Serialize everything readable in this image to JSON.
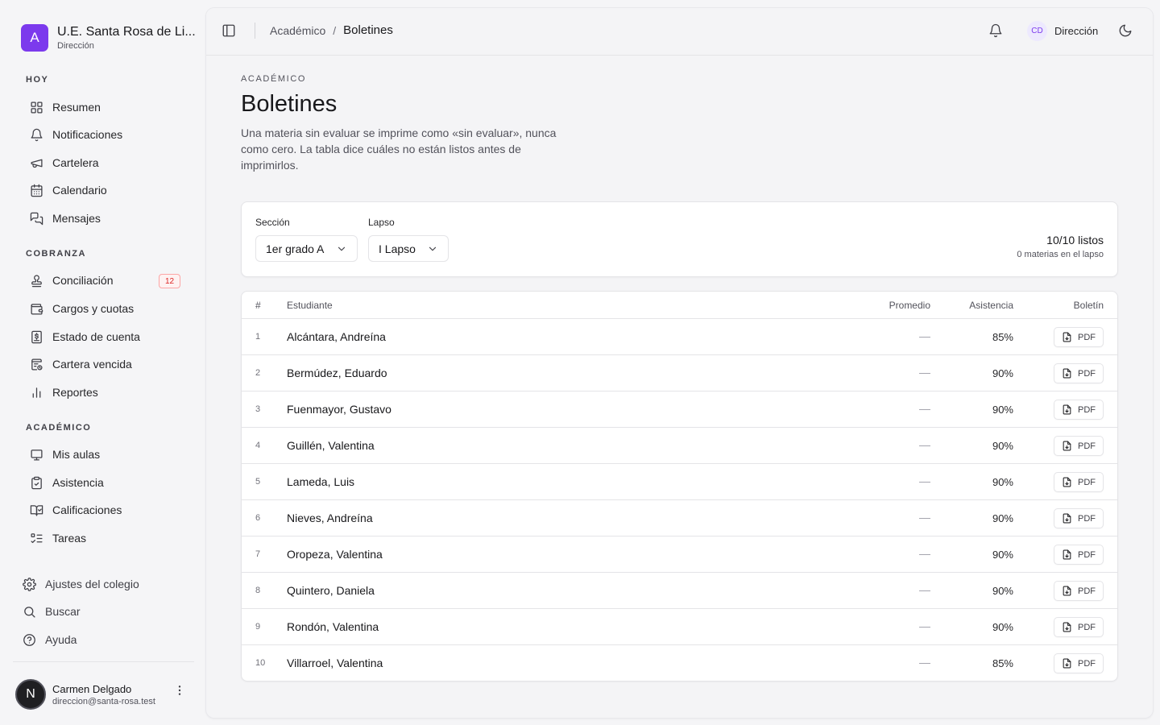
{
  "brand": {
    "logo_letter": "A",
    "name": "U.E. Santa Rosa de Li...",
    "role": "Dirección"
  },
  "sidebar": {
    "groups": [
      {
        "label": "HOY",
        "items": [
          {
            "label": "Resumen",
            "icon": "grid-icon"
          },
          {
            "label": "Notificaciones",
            "icon": "bell-icon"
          },
          {
            "label": "Cartelera",
            "icon": "megaphone-icon"
          },
          {
            "label": "Calendario",
            "icon": "calendar-icon"
          },
          {
            "label": "Mensajes",
            "icon": "chat-icon"
          }
        ]
      },
      {
        "label": "COBRANZA",
        "items": [
          {
            "label": "Conciliación",
            "icon": "stamp-icon",
            "badge": "12"
          },
          {
            "label": "Cargos y cuotas",
            "icon": "wallet-icon"
          },
          {
            "label": "Estado de cuenta",
            "icon": "receipt-dollar-icon"
          },
          {
            "label": "Cartera vencida",
            "icon": "receipt-clock-icon"
          },
          {
            "label": "Reportes",
            "icon": "bar-chart-icon"
          }
        ]
      },
      {
        "label": "ACADÉMICO",
        "items": [
          {
            "label": "Mis aulas",
            "icon": "presentation-icon"
          },
          {
            "label": "Asistencia",
            "icon": "clipboard-check-icon"
          },
          {
            "label": "Calificaciones",
            "icon": "book-check-icon"
          },
          {
            "label": "Tareas",
            "icon": "list-todo-icon"
          }
        ]
      }
    ],
    "bottom": [
      {
        "label": "Ajustes del colegio",
        "icon": "gear-icon"
      },
      {
        "label": "Buscar",
        "icon": "search-icon"
      },
      {
        "label": "Ayuda",
        "icon": "help-circle-icon"
      }
    ],
    "user": {
      "initial": "N",
      "name": "Carmen Delgado",
      "email": "direccion@santa-rosa.test"
    }
  },
  "topbar": {
    "breadcrumb": {
      "parent": "Académico",
      "separator": "/",
      "current": "Boletines"
    },
    "account": {
      "initials": "CD",
      "name": "Dirección"
    }
  },
  "page": {
    "eyebrow": "ACADÉMICO",
    "title": "Boletines",
    "description": "Una materia sin evaluar se imprime como «sin evaluar», nunca como cero. La tabla dice cuáles no están listos antes de imprimirlos."
  },
  "filters": {
    "section_label": "Sección",
    "section_value": "1er grado A",
    "term_label": "Lapso",
    "term_value": "I Lapso",
    "ready_count": "10/10 listos",
    "ready_sub": "0 materias en el lapso"
  },
  "table": {
    "headers": {
      "num": "#",
      "student": "Estudiante",
      "average": "Promedio",
      "attendance": "Asistencia",
      "report": "Boletín"
    },
    "pdf_label": "PDF",
    "rows": [
      {
        "num": "1",
        "name": "Alcántara, Andreína",
        "average": "—",
        "attendance": "85%"
      },
      {
        "num": "2",
        "name": "Bermúdez, Eduardo",
        "average": "—",
        "attendance": "90%"
      },
      {
        "num": "3",
        "name": "Fuenmayor, Gustavo",
        "average": "—",
        "attendance": "90%"
      },
      {
        "num": "4",
        "name": "Guillén, Valentina",
        "average": "—",
        "attendance": "90%"
      },
      {
        "num": "5",
        "name": "Lameda, Luis",
        "average": "—",
        "attendance": "90%"
      },
      {
        "num": "6",
        "name": "Nieves, Andreína",
        "average": "—",
        "attendance": "90%"
      },
      {
        "num": "7",
        "name": "Oropeza, Valentina",
        "average": "—",
        "attendance": "90%"
      },
      {
        "num": "8",
        "name": "Quintero, Daniela",
        "average": "—",
        "attendance": "90%"
      },
      {
        "num": "9",
        "name": "Rondón, Valentina",
        "average": "—",
        "attendance": "90%"
      },
      {
        "num": "10",
        "name": "Villarroel, Valentina",
        "average": "—",
        "attendance": "85%"
      }
    ]
  },
  "colors": {
    "accent": "#7c3aed",
    "badge": "#dc2626"
  }
}
